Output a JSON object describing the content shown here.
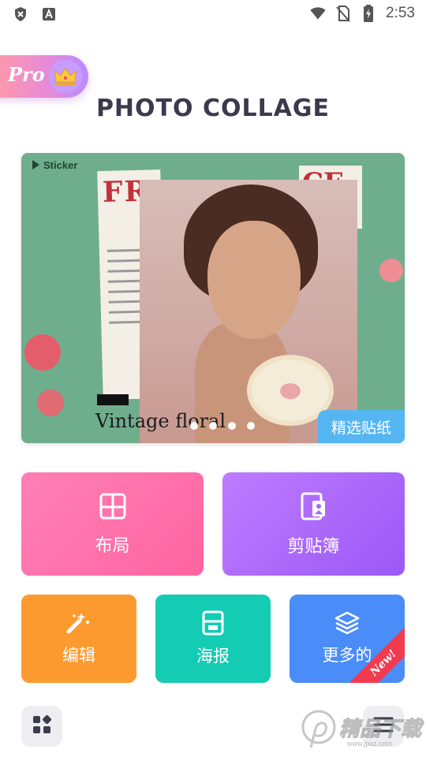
{
  "status_bar": {
    "time": "2:53",
    "left_icons": [
      "shield-icon",
      "font-a-icon"
    ],
    "right_icons": [
      "wifi-icon",
      "no-sim-icon",
      "battery-charging-icon"
    ]
  },
  "pro_badge": {
    "label": "Pro",
    "icon": "crown-icon"
  },
  "app_title": "PHOTO COLLAGE",
  "banner": {
    "sticker_label": "Sticker",
    "caption": "Vintage floral",
    "tag": "精选贴纸",
    "page_dots": 4
  },
  "features": {
    "layout": {
      "label": "布局",
      "icon": "layout-grid-icon",
      "color": "#ff6ea8"
    },
    "scrapbook": {
      "label": "剪贴簿",
      "icon": "scrapbook-icon",
      "color": "#a565fa"
    },
    "edit": {
      "label": "编辑",
      "icon": "magic-wand-icon",
      "color": "#fd9a2f"
    },
    "poster": {
      "label": "海报",
      "icon": "poster-icon",
      "color": "#14cbb3"
    },
    "more": {
      "label": "更多的",
      "icon": "layers-icon",
      "badge": "New!",
      "color": "#4a8cf8"
    }
  },
  "bottom": {
    "left_button_icon": "apps-icon",
    "right_button_icon": "menu-icon"
  },
  "watermark": {
    "text": "精品下载",
    "url": "www.jpxz.com"
  }
}
